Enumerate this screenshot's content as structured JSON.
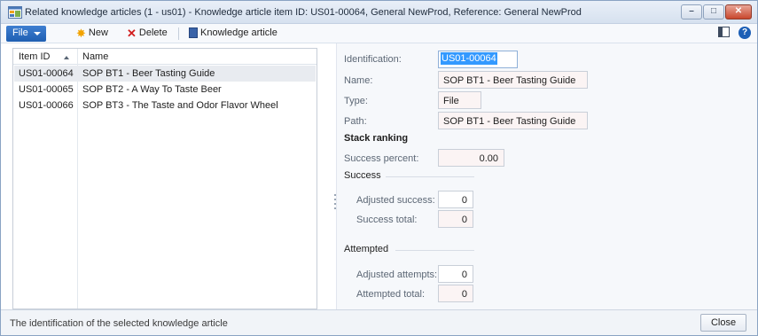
{
  "window": {
    "title": "Related knowledge articles (1 - us01) - Knowledge article item ID: US01-00064, General NewProd, Reference: General NewProd",
    "min_glyph": "–",
    "max_glyph": "□",
    "close_glyph": "✕"
  },
  "toolbar": {
    "file_label": "File",
    "new_label": "New",
    "delete_label": "Delete",
    "knowledge_article_label": "Knowledge article",
    "help_glyph": "?"
  },
  "grid": {
    "columns": {
      "item_id": "Item ID",
      "name": "Name"
    },
    "rows": [
      {
        "id": "US01-00064",
        "name": "SOP BT1 - Beer Tasting Guide"
      },
      {
        "id": "US01-00065",
        "name": "SOP BT2 - A Way To Taste Beer"
      },
      {
        "id": "US01-00066",
        "name": "SOP BT3 - The Taste and Odor Flavor Wheel"
      }
    ]
  },
  "details": {
    "identification_label": "Identification:",
    "identification_value": "US01-00064",
    "name_label": "Name:",
    "name_value": "SOP BT1 - Beer Tasting Guide",
    "type_label": "Type:",
    "type_value": "File",
    "path_label": "Path:",
    "path_value": "SOP BT1 - Beer Tasting Guide",
    "stack_ranking_title": "Stack ranking",
    "success_percent_label": "Success percent:",
    "success_percent_value": "0.00",
    "success_group": "Success",
    "adjusted_success_label": "Adjusted success:",
    "adjusted_success_value": "0",
    "success_total_label": "Success total:",
    "success_total_value": "0",
    "attempted_group": "Attempted",
    "adjusted_attempts_label": "Adjusted attempts:",
    "adjusted_attempts_value": "0",
    "attempted_total_label": "Attempted total:",
    "attempted_total_value": "0"
  },
  "statusbar": {
    "text": "The identification of the selected knowledge article",
    "close_label": "Close"
  },
  "colors": {
    "file_button": "#2a6cc4",
    "selected_text_highlight": "#3399ff",
    "read_only_field": "#fbf4f4"
  },
  "icons": {
    "app": "app-form-icon",
    "new": "star-icon",
    "delete": "red-x-icon",
    "knowledge_article": "book-icon",
    "layout": "layout-icon",
    "help": "help-icon"
  }
}
